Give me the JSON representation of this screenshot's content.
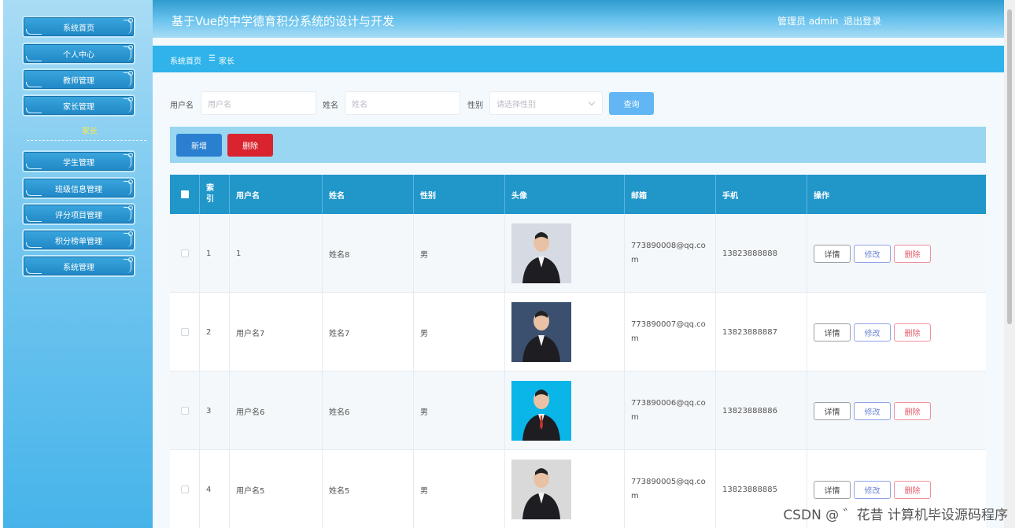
{
  "header": {
    "title": "基于Vue的中学德育积分系统的设计与开发",
    "user": "管理员 admin",
    "logout": "退出登录"
  },
  "sidebar": {
    "items": [
      {
        "label": "系统首页"
      },
      {
        "label": "个人中心"
      },
      {
        "label": "教师管理"
      },
      {
        "label": "家长管理"
      },
      {
        "label": "学生管理"
      },
      {
        "label": "班级信息管理"
      },
      {
        "label": "评分项目管理"
      },
      {
        "label": "积分榜单管理"
      },
      {
        "label": "系统管理"
      }
    ],
    "submenu": "家长"
  },
  "breadcrumb": {
    "home": "系统首页",
    "sep": "☰",
    "current": "家长"
  },
  "search": {
    "username_label": "用户名",
    "username_placeholder": "用户名",
    "name_label": "姓名",
    "name_placeholder": "姓名",
    "gender_label": "性别",
    "gender_placeholder": "请选择性别",
    "query": "查询"
  },
  "toolbar": {
    "add": "新增",
    "delete": "删除"
  },
  "table": {
    "headers": [
      "",
      "索引",
      "用户名",
      "姓名",
      "性别",
      "头像",
      "邮箱",
      "手机",
      "操作"
    ],
    "rows": [
      {
        "index": "1",
        "username": "1",
        "name": "姓名8",
        "gender": "男",
        "email": "773890008@qq.co\nm",
        "phone": "13823888888"
      },
      {
        "index": "2",
        "username": "用户名7",
        "name": "姓名7",
        "gender": "男",
        "email": "773890007@qq.co\nm",
        "phone": "13823888887"
      },
      {
        "index": "3",
        "username": "用户名6",
        "name": "姓名6",
        "gender": "男",
        "email": "773890006@qq.co\nm",
        "phone": "13823888886"
      },
      {
        "index": "4",
        "username": "用户名5",
        "name": "姓名5",
        "gender": "男",
        "email": "773890005@qq.co\nm",
        "phone": "13823888885"
      }
    ],
    "actions": {
      "detail": "详情",
      "edit": "修改",
      "delete": "删除"
    }
  },
  "watermark": "CSDN @ ゛花昔  计算机毕设源码程序",
  "colors": {
    "header": "#2f9ccf",
    "table_header": "#2196c9",
    "delete_btn": "#d9242f",
    "add_btn": "#2b7fd0",
    "query_btn": "#62b6f4"
  }
}
